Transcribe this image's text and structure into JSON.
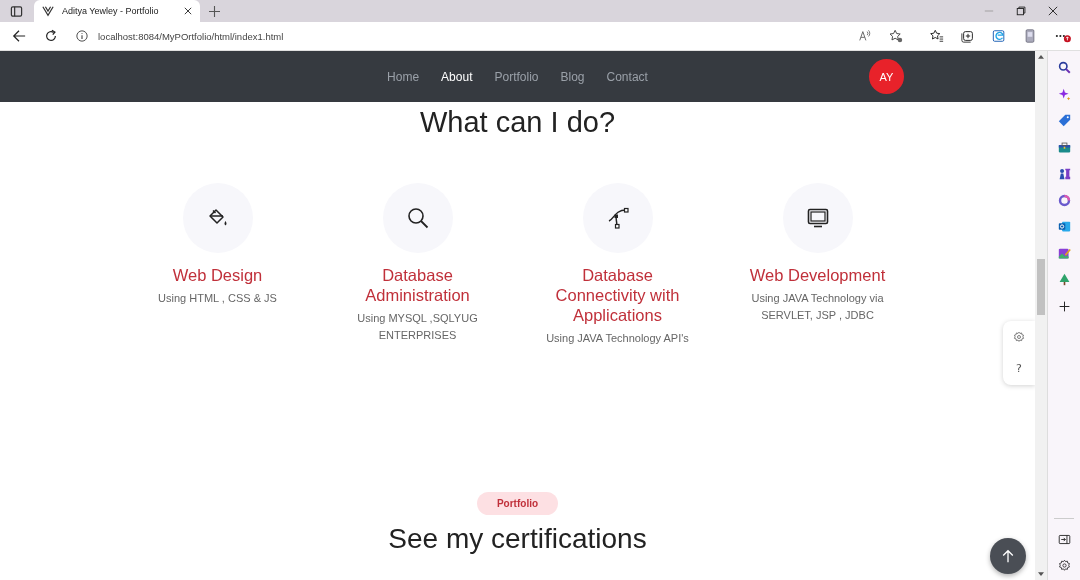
{
  "browser": {
    "tab_title": "Aditya Yewley - Portfolio",
    "url": "localhost:8084/MyPOrtfolio/html/index1.html"
  },
  "navbar": {
    "items": [
      {
        "label": "Home",
        "selected": false
      },
      {
        "label": "About",
        "selected": true
      },
      {
        "label": "Portfolio",
        "selected": false
      },
      {
        "label": "Blog",
        "selected": false
      },
      {
        "label": "Contact",
        "selected": false
      }
    ],
    "avatar": "AY"
  },
  "services_heading": "What can I do?",
  "services": [
    {
      "kind": "design",
      "title": "Web Design",
      "description": "Using HTML , CSS & JS"
    },
    {
      "kind": "database",
      "title": "Database Administration",
      "description": "Using MYSQL ,SQLYUG ENTERPRISES"
    },
    {
      "kind": "connectivity",
      "title": "Database Connectivity with Applications",
      "description": "Using JAVA Technology API's"
    },
    {
      "kind": "development",
      "title": "Web Development",
      "description": "Using JAVA Technology via SERVLET, JSP , JDBC"
    }
  ],
  "float_panel": {
    "help": "?"
  },
  "portfolio": {
    "badge": "Portfolio",
    "heading": "See my certifications"
  }
}
